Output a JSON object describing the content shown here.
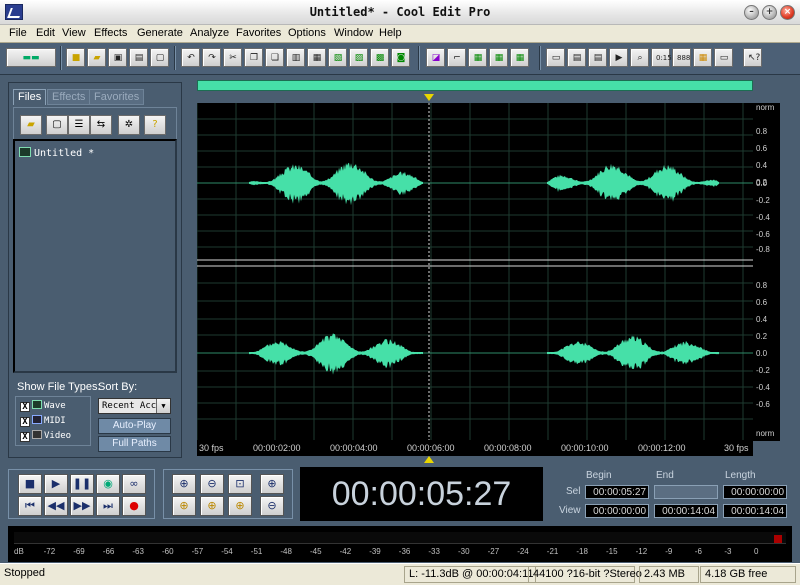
{
  "window": {
    "title": "Untitled* - Cool Edit Pro"
  },
  "menu": [
    "File",
    "Edit",
    "View",
    "Effects",
    "Generate",
    "Analyze",
    "Favorites",
    "Options",
    "Window",
    "Help"
  ],
  "left_panel": {
    "tabs": [
      "Files",
      "Effects",
      "Favorites"
    ],
    "files": [
      "Untitled *"
    ],
    "show_file_types_label": "Show File Types:",
    "sort_by_label": "Sort By:",
    "file_types": [
      {
        "label": "Wave",
        "checked_mark": "X"
      },
      {
        "label": "MIDI",
        "checked_mark": "X"
      },
      {
        "label": "Video",
        "checked_mark": "X"
      }
    ],
    "sort_value": "Recent Acc",
    "auto_play_label": "Auto-Play",
    "full_paths_label": "Full Paths"
  },
  "waveform": {
    "scale_top_label": "norm",
    "scale_bottom_label": "norm",
    "channel1_ticks": [
      "0.8",
      "0.6",
      "0.4",
      "0.2",
      "0.0",
      "-0.2",
      "-0.4",
      "-0.6",
      "-0.8"
    ],
    "channel2_ticks": [
      "0.8",
      "0.6",
      "0.4",
      "0.2",
      "0.0",
      "-0.2",
      "-0.4",
      "-0.6"
    ],
    "ruler": [
      "30 fps",
      "00:00:02:00",
      "00:00:04:00",
      "00:00:06:00",
      "00:00:08:00",
      "00:00:10:00",
      "00:00:12:00",
      "30 fps"
    ],
    "wave_color": "#46e0a8"
  },
  "time_display": "00:00:05:27",
  "selection": {
    "headers": [
      "Begin",
      "End",
      "Length"
    ],
    "sel_label": "Sel",
    "view_label": "View",
    "sel": [
      "00:00:05:27",
      "",
      "00:00:00:00"
    ],
    "view": [
      "00:00:00:00",
      "00:00:14:04",
      "00:00:14:04"
    ]
  },
  "meter_labels": [
    "dB",
    "-72",
    "-69",
    "-66",
    "-63",
    "-60",
    "-57",
    "-54",
    "-51",
    "-48",
    "-45",
    "-42",
    "-39",
    "-36",
    "-33",
    "-30",
    "-27",
    "-24",
    "-21",
    "-18",
    "-15",
    "-12",
    "-9",
    "-6",
    "-3",
    "0"
  ],
  "status": {
    "state": "Stopped",
    "level": "L: -11.3dB @ 00:00:04:11",
    "format": "44100 ?16-bit ?Stereo",
    "size": "2.43 MB",
    "free": "4.18 GB free"
  }
}
